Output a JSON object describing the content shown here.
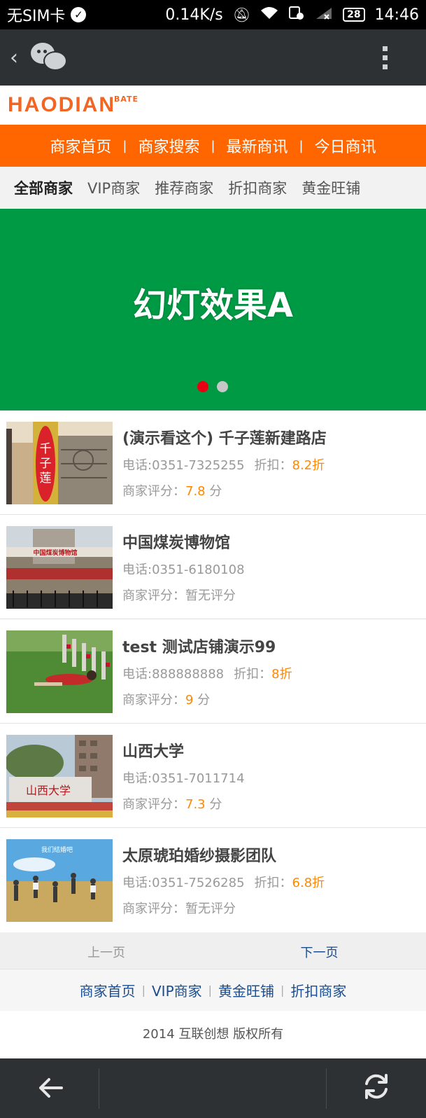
{
  "status_bar": {
    "carrier": "无SIM卡",
    "speed": "0.14K/s",
    "battery": "28",
    "time": "14:46",
    "icons": [
      "check-circle-icon",
      "mute-icon",
      "wifi-icon",
      "data-saver-icon",
      "signal-icon",
      "battery-icon"
    ]
  },
  "app_bar": {
    "icons": [
      "back-chevron-icon",
      "wechat-icon",
      "overflow-menu-icon"
    ]
  },
  "logo": {
    "text": "HAODIAN",
    "superscript": "BATE"
  },
  "top_nav": {
    "items": [
      "商家首页",
      "商家搜索",
      "最新商讯",
      "今日商讯"
    ],
    "separator": "|"
  },
  "sub_nav": {
    "items": [
      "全部商家",
      "VIP商家",
      "推荐商家",
      "折扣商家",
      "黄金旺铺"
    ],
    "active": "全部商家"
  },
  "banner": {
    "text": "幻灯效果A",
    "slide_count": 2,
    "active_slide": 1
  },
  "merchants": [
    {
      "name": "(演示看这个) 千子莲新建路店",
      "phone": "电话:0351-7325255",
      "discount_label": "折扣：",
      "discount": "8.2折",
      "rating_label": "商家评分：",
      "rating": "7.8",
      "rating_unit": "分",
      "thumb_text": "千子莲"
    },
    {
      "name": "中国煤炭博物馆",
      "phone": "电话:0351-6180108",
      "discount_label": "",
      "discount": "",
      "rating_label": "商家评分：",
      "rating": "暂无评分",
      "rating_unit": "",
      "thumb_text": "中国煤炭博物馆"
    },
    {
      "name": "test 测试店铺演示99",
      "phone": "电话:888888888",
      "discount_label": "折扣：",
      "discount": "8折",
      "rating_label": "商家评分：",
      "rating": "9",
      "rating_unit": "分",
      "thumb_text": ""
    },
    {
      "name": "山西大学",
      "phone": "电话:0351-7011714",
      "discount_label": "",
      "discount": "",
      "rating_label": "商家评分：",
      "rating": "7.3",
      "rating_unit": "分",
      "thumb_text": "山西大学"
    },
    {
      "name": "太原琥珀婚纱摄影团队",
      "phone": "电话:0351-7526285",
      "discount_label": "折扣：",
      "discount": "6.8折",
      "rating_label": "商家评分：",
      "rating": "暂无评分",
      "rating_unit": "",
      "thumb_text": "我们结婚吧"
    }
  ],
  "pager": {
    "prev": "上一页",
    "next": "下一页"
  },
  "footer_links": {
    "items": [
      "商家首页",
      "VIP商家",
      "黄金旺铺",
      "折扣商家"
    ],
    "separator": "|"
  },
  "copyright": "2014 互联创想 版权所有",
  "bottom_bar": {
    "icons": [
      "back-arrow-icon",
      "refresh-icon"
    ]
  },
  "colors": {
    "accent": "#ff6600",
    "banner": "#009944",
    "rating": "#ff8800",
    "link": "#1a4d8f"
  }
}
